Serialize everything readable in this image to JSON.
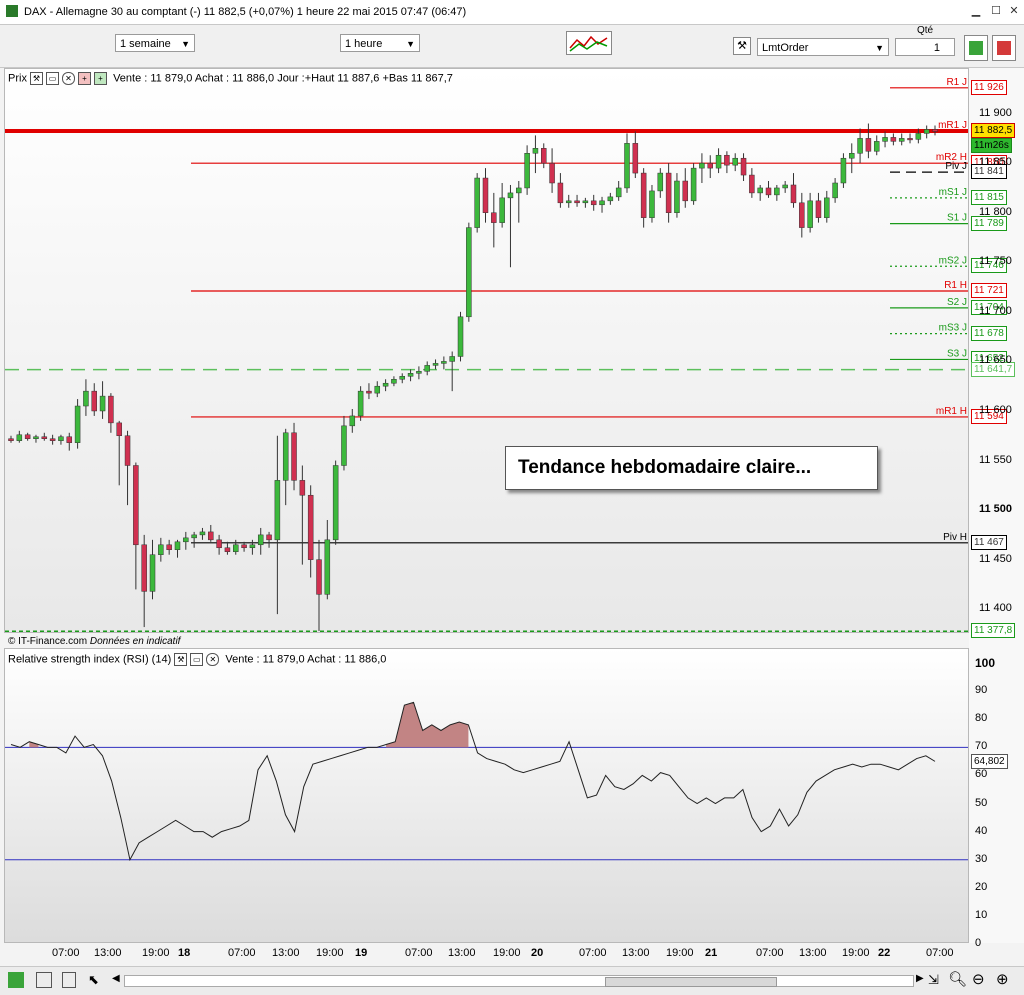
{
  "window": {
    "title": "DAX - Allemagne 30 au comptant (-)    11 882,5 (+0,07%)    1 heure  22 mai 2015 07:47 (06:47)"
  },
  "toolbar": {
    "period": "1 semaine",
    "interval": "1 heure",
    "order_type": "LmtOrder",
    "qty_label": "Qté",
    "qty_value": "1"
  },
  "price_panel": {
    "title": "Prix",
    "info": "Vente : 11 879,0 Achat : 11 886,0 Jour :+Haut 11 887,6 +Bas 11 867,7",
    "source": "© IT-Finance.com",
    "source_note": "Données en indicatif"
  },
  "rsi_panel": {
    "title": "Relative strength index (RSI) (14)",
    "info": "Vente : 11 879,0 Achat : 11 886,0"
  },
  "annotation": "Tendance hebdomadaire claire...",
  "chart_data": [
    {
      "type": "candlestick",
      "ylim": [
        11375,
        11945
      ],
      "price_ticks": [
        "11 900",
        "11 850",
        "11 800",
        "11 750",
        "11 700",
        "11 650",
        "11 600",
        "11 550",
        "11 500",
        "11 450",
        "11 400"
      ],
      "x_ticks": [
        "07:00",
        "13:00",
        "19:00",
        "18",
        "07:00",
        "13:00",
        "19:00",
        "19",
        "07:00",
        "13:00",
        "19:00",
        "20",
        "07:00",
        "13:00",
        "19:00",
        "21",
        "07:00",
        "13:00",
        "19:00",
        "22",
        "07:00"
      ],
      "current_price": "11 882,5",
      "countdown": "11m26s",
      "levels": [
        {
          "name": "R1 J",
          "value": 11926,
          "label": "11 926",
          "color": "#e00000",
          "style": "solid"
        },
        {
          "name": "mR1 J",
          "value": 11882.5,
          "label": "11 882,5",
          "color": "#e00000",
          "style": "solid"
        },
        {
          "name": "mR2 H",
          "value": 11850,
          "label": "11 850",
          "color": "#e00000",
          "style": "solid"
        },
        {
          "name": "Piv J",
          "value": 11841,
          "label": "11 841",
          "color": "#000000",
          "style": "dashed"
        },
        {
          "name": "mS1 J",
          "value": 11815,
          "label": "11 815",
          "color": "#1a9a1a",
          "style": "dotted"
        },
        {
          "name": "S1 J",
          "value": 11789,
          "label": "11 789",
          "color": "#1a9a1a",
          "style": "solid"
        },
        {
          "name": "mS2 J",
          "value": 11746,
          "label": "11 746",
          "color": "#1a9a1a",
          "style": "dotted"
        },
        {
          "name": "R1 H",
          "value": 11721,
          "label": "11 721",
          "color": "#e00000",
          "style": "solid"
        },
        {
          "name": "S2 J",
          "value": 11704,
          "label": "11 704",
          "color": "#1a9a1a",
          "style": "solid"
        },
        {
          "name": "mS3 J",
          "value": 11678,
          "label": "11 678",
          "color": "#1a9a1a",
          "style": "dotted"
        },
        {
          "name": "S3 J",
          "value": 11652,
          "label": "11 652",
          "color": "#1a9a1a",
          "style": "solid"
        },
        {
          "name": "",
          "value": 11641.7,
          "label": "11 641,7",
          "color": "#5cc05c",
          "style": "longdash"
        },
        {
          "name": "mR1 H",
          "value": 11594,
          "label": "11 594",
          "color": "#e00000",
          "style": "solid"
        },
        {
          "name": "Piv H",
          "value": 11467,
          "label": "11 467",
          "color": "#000000",
          "style": "solid"
        },
        {
          "name": "",
          "value": 11377.8,
          "label": "11 377,8",
          "color": "#1a9a1a",
          "style": "dashed"
        }
      ],
      "candles": [
        [
          11572,
          11575,
          11568,
          11570
        ],
        [
          11570,
          11580,
          11568,
          11576
        ],
        [
          11576,
          11578,
          11570,
          11572
        ],
        [
          11572,
          11576,
          11568,
          11574
        ],
        [
          11574,
          11578,
          11570,
          11572
        ],
        [
          11572,
          11576,
          11566,
          11570
        ],
        [
          11570,
          11576,
          11566,
          11574
        ],
        [
          11574,
          11578,
          11560,
          11568
        ],
        [
          11568,
          11612,
          11562,
          11605
        ],
        [
          11605,
          11632,
          11595,
          11620
        ],
        [
          11620,
          11628,
          11595,
          11600
        ],
        [
          11600,
          11630,
          11592,
          11615
        ],
        [
          11615,
          11618,
          11578,
          11588
        ],
        [
          11588,
          11590,
          11525,
          11575
        ],
        [
          11575,
          11580,
          11505,
          11545
        ],
        [
          11545,
          11548,
          11420,
          11465
        ],
        [
          11465,
          11475,
          11382,
          11418
        ],
        [
          11418,
          11470,
          11410,
          11455
        ],
        [
          11455,
          11472,
          11448,
          11465
        ],
        [
          11465,
          11470,
          11455,
          11460
        ],
        [
          11460,
          11470,
          11452,
          11468
        ],
        [
          11468,
          11478,
          11460,
          11472
        ],
        [
          11472,
          11478,
          11462,
          11475
        ],
        [
          11475,
          11482,
          11470,
          11478
        ],
        [
          11478,
          11485,
          11468,
          11470
        ],
        [
          11470,
          11475,
          11455,
          11462
        ],
        [
          11462,
          11468,
          11455,
          11458
        ],
        [
          11458,
          11470,
          11455,
          11465
        ],
        [
          11465,
          11468,
          11458,
          11462
        ],
        [
          11462,
          11470,
          11455,
          11465
        ],
        [
          11465,
          11482,
          11455,
          11475
        ],
        [
          11475,
          11478,
          11462,
          11470
        ],
        [
          11470,
          11575,
          11395,
          11530
        ],
        [
          11530,
          11582,
          11505,
          11578
        ],
        [
          11578,
          11588,
          11520,
          11530
        ],
        [
          11530,
          11545,
          11445,
          11515
        ],
        [
          11515,
          11525,
          11432,
          11450
        ],
        [
          11450,
          11470,
          11378,
          11415
        ],
        [
          11415,
          11490,
          11410,
          11470
        ],
        [
          11470,
          11550,
          11465,
          11545
        ],
        [
          11545,
          11595,
          11540,
          11585
        ],
        [
          11585,
          11602,
          11578,
          11595
        ],
        [
          11595,
          11625,
          11590,
          11620
        ],
        [
          11620,
          11628,
          11612,
          11618
        ],
        [
          11618,
          11630,
          11614,
          11625
        ],
        [
          11625,
          11632,
          11620,
          11628
        ],
        [
          11628,
          11635,
          11625,
          11632
        ],
        [
          11632,
          11638,
          11628,
          11635
        ],
        [
          11635,
          11642,
          11630,
          11638
        ],
        [
          11638,
          11645,
          11632,
          11640
        ],
        [
          11640,
          11650,
          11636,
          11646
        ],
        [
          11646,
          11652,
          11642,
          11648
        ],
        [
          11648,
          11655,
          11642,
          11650
        ],
        [
          11650,
          11660,
          11620,
          11655
        ],
        [
          11655,
          11700,
          11650,
          11695
        ],
        [
          11695,
          11790,
          11690,
          11785
        ],
        [
          11785,
          11840,
          11780,
          11835
        ],
        [
          11835,
          11845,
          11790,
          11800
        ],
        [
          11800,
          11820,
          11765,
          11790
        ],
        [
          11790,
          11830,
          11785,
          11815
        ],
        [
          11815,
          11828,
          11745,
          11820
        ],
        [
          11820,
          11832,
          11790,
          11825
        ],
        [
          11825,
          11868,
          11818,
          11860
        ],
        [
          11860,
          11878,
          11840,
          11865
        ],
        [
          11865,
          11870,
          11845,
          11850
        ],
        [
          11850,
          11865,
          11820,
          11830
        ],
        [
          11830,
          11840,
          11805,
          11810
        ],
        [
          11810,
          11818,
          11805,
          11812
        ],
        [
          11812,
          11818,
          11806,
          11810
        ],
        [
          11810,
          11815,
          11805,
          11812
        ],
        [
          11812,
          11818,
          11802,
          11808
        ],
        [
          11808,
          11816,
          11800,
          11812
        ],
        [
          11812,
          11820,
          11808,
          11816
        ],
        [
          11816,
          11832,
          11812,
          11825
        ],
        [
          11825,
          11880,
          11820,
          11870
        ],
        [
          11870,
          11882,
          11835,
          11840
        ],
        [
          11840,
          11845,
          11785,
          11795
        ],
        [
          11795,
          11828,
          11790,
          11822
        ],
        [
          11822,
          11845,
          11815,
          11840
        ],
        [
          11840,
          11850,
          11790,
          11800
        ],
        [
          11800,
          11840,
          11795,
          11832
        ],
        [
          11832,
          11845,
          11805,
          11812
        ],
        [
          11812,
          11850,
          11808,
          11845
        ],
        [
          11845,
          11860,
          11830,
          11850
        ],
        [
          11850,
          11858,
          11835,
          11845
        ],
        [
          11845,
          11865,
          11840,
          11858
        ],
        [
          11858,
          11862,
          11840,
          11848
        ],
        [
          11848,
          11860,
          11842,
          11855
        ],
        [
          11855,
          11860,
          11832,
          11838
        ],
        [
          11838,
          11845,
          11815,
          11820
        ],
        [
          11820,
          11828,
          11812,
          11825
        ],
        [
          11825,
          11832,
          11815,
          11818
        ],
        [
          11818,
          11828,
          11812,
          11825
        ],
        [
          11825,
          11832,
          11820,
          11828
        ],
        [
          11828,
          11840,
          11805,
          11810
        ],
        [
          11810,
          11820,
          11775,
          11785
        ],
        [
          11785,
          11820,
          11780,
          11812
        ],
        [
          11812,
          11820,
          11790,
          11795
        ],
        [
          11795,
          11822,
          11790,
          11815
        ],
        [
          11815,
          11835,
          11810,
          11830
        ],
        [
          11830,
          11860,
          11825,
          11855
        ],
        [
          11855,
          11870,
          11840,
          11860
        ],
        [
          11860,
          11885,
          11850,
          11875
        ],
        [
          11875,
          11890,
          11855,
          11862
        ],
        [
          11862,
          11878,
          11858,
          11872
        ],
        [
          11872,
          11882,
          11866,
          11876
        ],
        [
          11876,
          11880,
          11868,
          11872
        ],
        [
          11872,
          11880,
          11868,
          11875
        ],
        [
          11875,
          11880,
          11870,
          11874
        ],
        [
          11874,
          11885,
          11870,
          11880
        ],
        [
          11880,
          11888,
          11875,
          11884
        ],
        [
          11884,
          11888,
          11878,
          11882
        ]
      ]
    },
    {
      "type": "line",
      "title": "Relative strength index (RSI) (14)",
      "ylim": [
        0,
        105
      ],
      "y_ticks": [
        100,
        90,
        80,
        70,
        60,
        50,
        40,
        30,
        20,
        10,
        0
      ],
      "levels": [
        70,
        30
      ],
      "last_value": "64,802",
      "values": [
        71,
        70,
        72,
        71,
        70,
        70,
        68,
        74,
        70,
        71,
        67,
        58,
        45,
        30,
        36,
        38,
        40,
        42,
        44,
        42,
        40,
        40,
        38,
        40,
        41,
        42,
        44,
        62,
        67,
        58,
        46,
        40,
        56,
        64,
        65,
        66,
        67,
        68,
        69,
        70,
        70,
        71,
        72,
        85,
        86,
        76,
        78,
        76,
        78,
        79,
        78,
        68,
        66,
        65,
        64,
        62,
        61,
        62,
        63,
        64,
        65,
        72,
        62,
        52,
        53,
        60,
        56,
        55,
        57,
        60,
        58,
        61,
        60,
        56,
        52,
        50,
        52,
        50,
        52,
        52,
        55,
        45,
        40,
        42,
        48,
        42,
        46,
        54,
        58,
        60,
        62,
        63,
        64,
        63,
        64,
        64,
        63,
        62,
        64,
        66,
        67,
        65
      ]
    }
  ]
}
